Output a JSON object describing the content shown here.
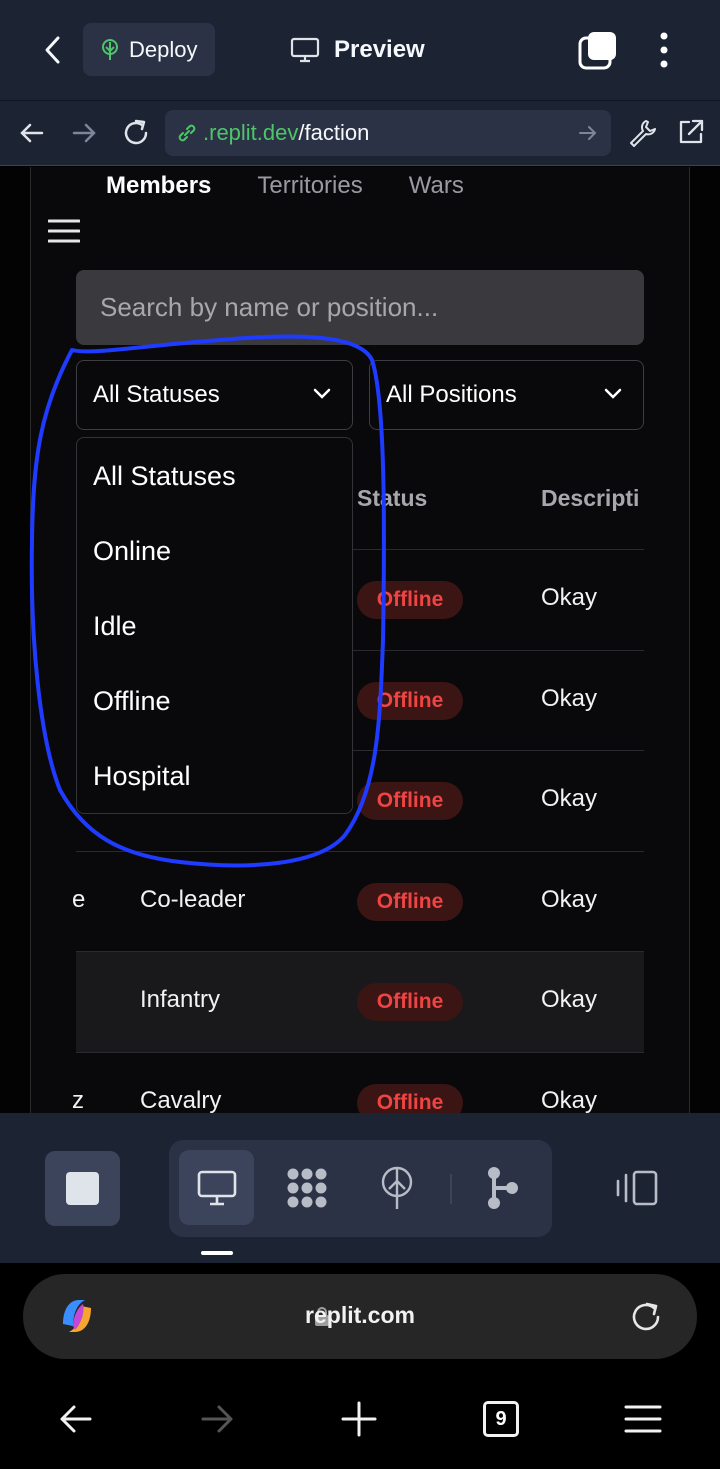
{
  "replit_header": {
    "deploy_label": "Deploy",
    "preview_label": "Preview"
  },
  "url_bar": {
    "host": ".replit.dev",
    "path": "/faction"
  },
  "app": {
    "tabs": [
      {
        "label": "Members",
        "active": true
      },
      {
        "label": "Territories",
        "active": false
      },
      {
        "label": "Wars",
        "active": false
      }
    ],
    "search_placeholder": "Search by name or position...",
    "status_filter": "All Statuses",
    "position_filter": "All Positions",
    "status_options": [
      "All Statuses",
      "Online",
      "Idle",
      "Offline",
      "Hospital"
    ],
    "columns": {
      "status": "Status",
      "description": "Descripti"
    },
    "rows": [
      {
        "position": "",
        "status": "Offline",
        "description": "Okay"
      },
      {
        "position": "",
        "status": "Offline",
        "description": "Okay"
      },
      {
        "position": "",
        "status": "Offline",
        "description": "Okay"
      },
      {
        "name_fragment": "e",
        "position": "Co-leader",
        "status": "Offline",
        "description": "Okay"
      },
      {
        "position": "Infantry",
        "status": "Offline",
        "description": "Okay"
      },
      {
        "name_fragment": "z",
        "position": "Cavalry",
        "status": "Offline",
        "description": "Okay"
      }
    ]
  },
  "browser": {
    "domain": "replit.com",
    "tab_count": "9"
  },
  "colors": {
    "annotation": "#1f3bff",
    "offline_text": "#ef4444",
    "url_host": "#4ec46a"
  }
}
